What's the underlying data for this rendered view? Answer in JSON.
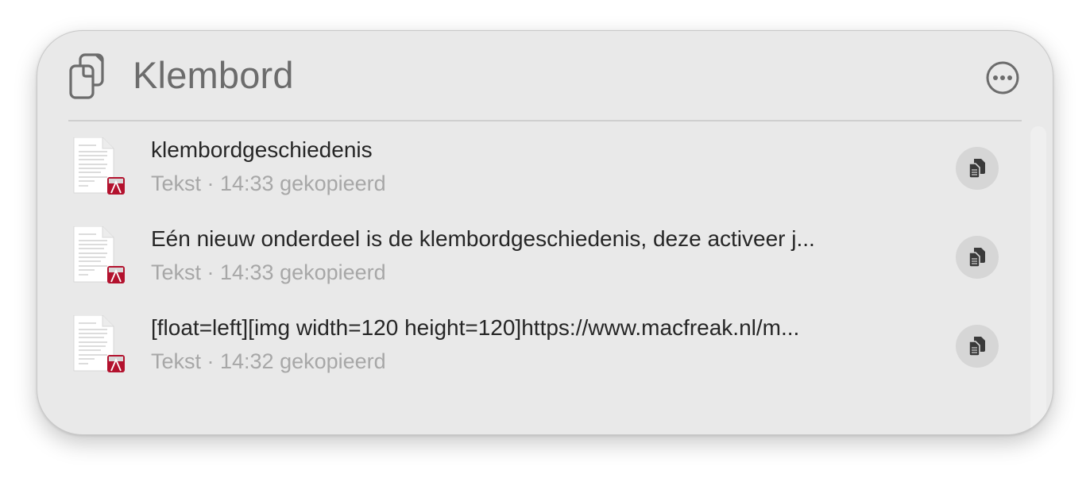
{
  "header": {
    "title": "Klembord",
    "icon": "clipboard-icon",
    "more_icon": "ellipsis-circle-icon"
  },
  "items": [
    {
      "title": "klembordgeschiedenis",
      "meta": "Tekst · 14:33 gekopieerd",
      "icon": "text-document-icon",
      "action_icon": "copy-icon"
    },
    {
      "title": "Eén nieuw onderdeel is de klembordgeschiedenis, deze activeer j...",
      "meta": "Tekst · 14:33 gekopieerd",
      "icon": "text-document-icon",
      "action_icon": "copy-icon"
    },
    {
      "title": "[float=left][img width=120 height=120]https://www.macfreak.nl/m...",
      "meta": "Tekst · 14:32 gekopieerd",
      "icon": "text-document-icon",
      "action_icon": "copy-icon"
    }
  ],
  "colors": {
    "panel_background": "#e9e9e9",
    "title_text": "#6c6c6c",
    "item_text": "#262626",
    "meta_text": "#a7a7a7",
    "button_background": "#d6d6d6",
    "badge_accent": "#b3122e"
  }
}
